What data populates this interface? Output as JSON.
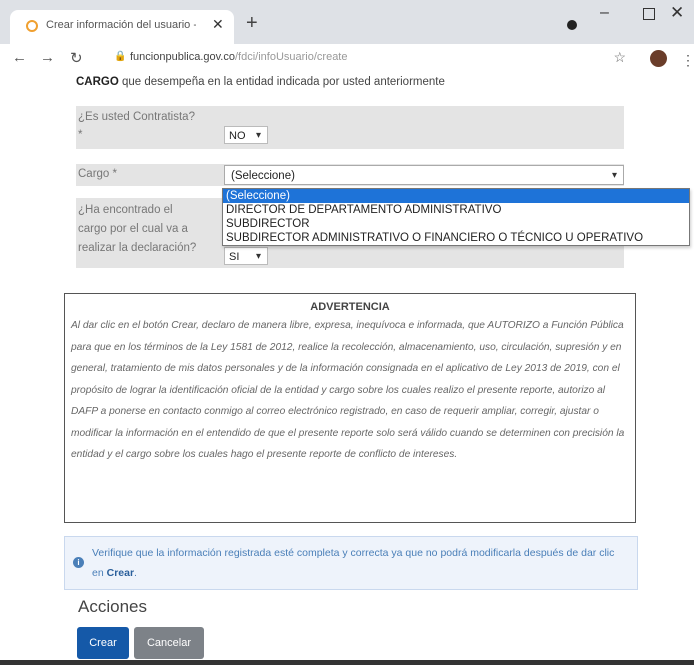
{
  "browser": {
    "tab_title": "Crear información del usuario - ",
    "url_domain": "funcionpublica.gov.co",
    "url_path": "/fdci/infoUsuario/create"
  },
  "intro": {
    "bold": "CARGO",
    "rest": " que desempeña en la entidad indicada por usted anteriormente"
  },
  "contratista": {
    "label": "¿Es usted Contratista?",
    "required_mark": "*",
    "value": "NO"
  },
  "cargo": {
    "label": "Cargo *",
    "value": "(Seleccione)",
    "options": [
      "(Seleccione)",
      "DIRECTOR DE DEPARTAMENTO ADMINISTRATIVO",
      "SUBDIRECTOR",
      "SUBDIRECTOR ADMINISTRATIVO O FINANCIERO O TÉCNICO U OPERATIVO"
    ]
  },
  "encontrado": {
    "label_lines": [
      "¿Ha encontrado el",
      "cargo por el cual va a",
      "realizar la declaración?"
    ],
    "value": "SI"
  },
  "advertencia": {
    "title": "ADVERTENCIA",
    "body": "Al dar clic en el botón Crear, declaro de manera libre, expresa, inequívoca e informada, que AUTORIZO a Función Pública para que en los términos de la Ley 1581 de 2012, realice la recolección, almacenamiento, uso, circulación, supresión y en general, tratamiento de mis datos personales y de la información consignada en el aplicativo de Ley 2013 de 2019, con el propósito de lograr la identificación oficial de la entidad y cargo sobre los cuales realizo el presente reporte, autorizo al DAFP a ponerse en contacto conmigo al correo electrónico registrado, en caso de requerir ampliar, corregir, ajustar o modificar la información en el entendido de que el presente reporte solo será válido cuando se determinen con precisión la entidad y el cargo sobre los cuales hago el presente reporte de conflicto de intereses."
  },
  "info": {
    "text": "Verifique que la información registrada esté completa y correcta ya que no podrá modificarla después de dar clic en ",
    "bold": "Crear",
    "end": "."
  },
  "acciones": {
    "title": "Acciones",
    "crear": "Crear",
    "cancelar": "Cancelar"
  },
  "icons": [
    "chrome-favicon",
    "close-icon",
    "plus-icon",
    "record-icon",
    "minimize-icon",
    "maximize-icon",
    "close-window-icon",
    "back-icon",
    "forward-icon",
    "reload-icon",
    "lock-icon",
    "star-icon",
    "avatar",
    "menu-icon",
    "chevron-down-icon",
    "info-icon"
  ]
}
